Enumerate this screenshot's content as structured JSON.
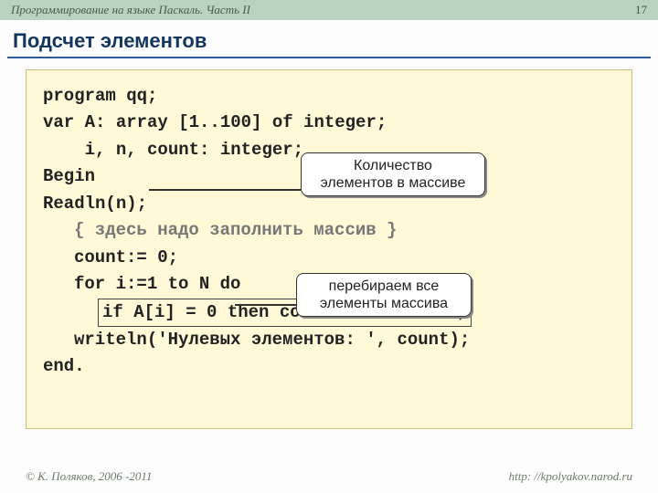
{
  "header": {
    "title": "Программирование на языке Паскаль. Часть II",
    "page": "17"
  },
  "slide_title": "Подсчет элементов",
  "code": {
    "l1": "program qq;",
    "l2": "var A: array [1..100] of integer;",
    "l3": "    i, n, count: integer;",
    "l4": "Begin",
    "l5": "Readln(n);",
    "l6": "{ здесь надо заполнить массив }",
    "l7": "count:= 0;",
    "l8": "for i:=1 to N do",
    "l9": "if A[i] = 0 then count:= count + 1;",
    "l10": "writeln('Нулевых элементов: ', count);",
    "l11": "end."
  },
  "callouts": {
    "c1a": "Количество",
    "c1b": "элементов в массиве",
    "c2a": "перебираем все",
    "c2b": "элементы массива"
  },
  "footer": {
    "left": "© К. Поляков, 2006 -2011",
    "right": "http: //kpolyakov.narod.ru"
  }
}
